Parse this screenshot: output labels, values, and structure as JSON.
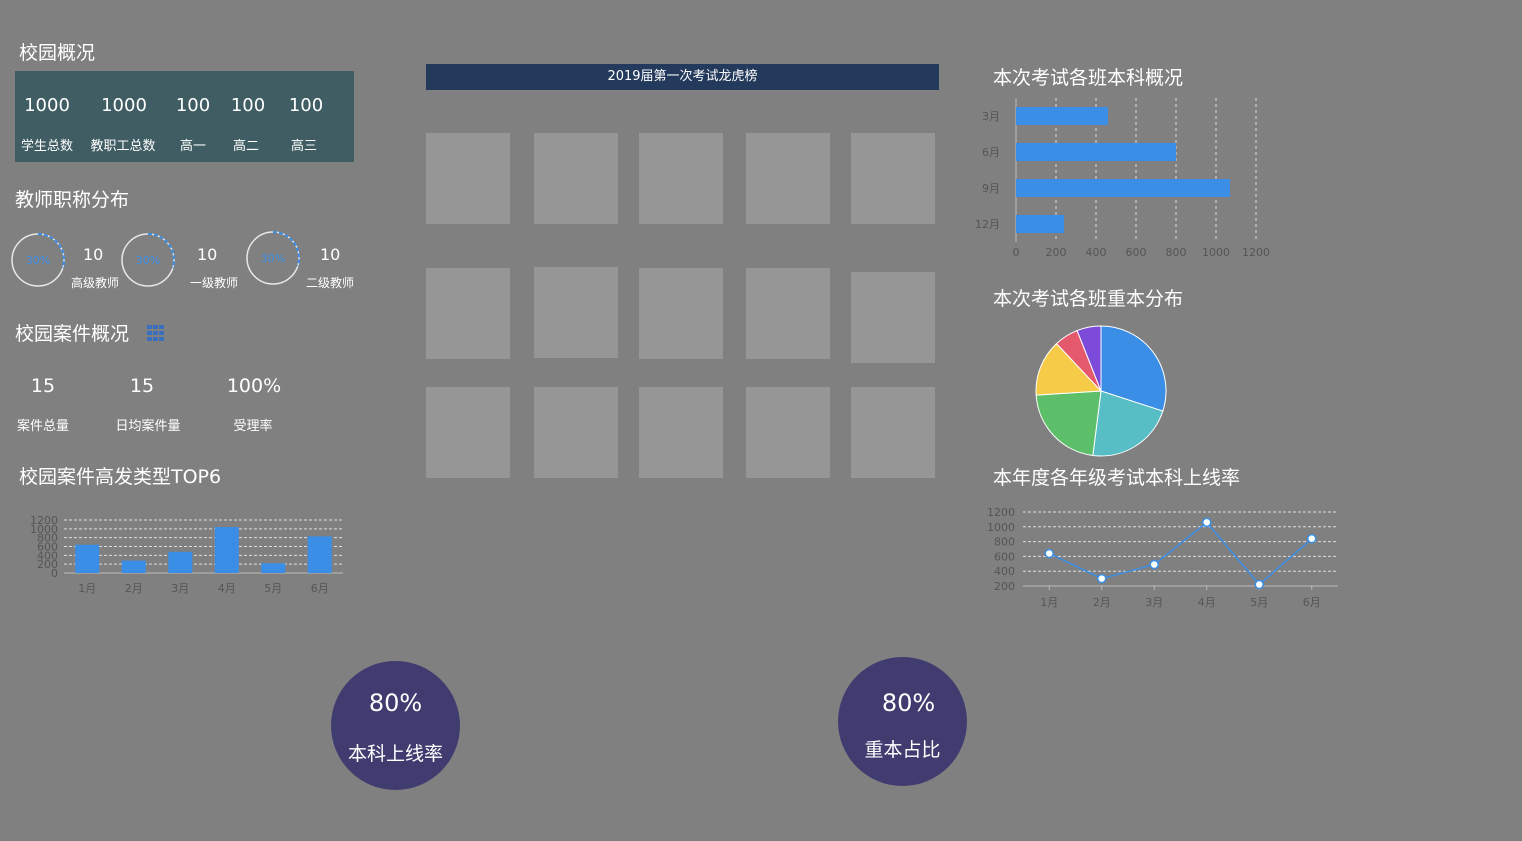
{
  "campus": {
    "title": "校园概况",
    "stats": [
      {
        "value": "1000",
        "label": "学生总数"
      },
      {
        "value": "1000",
        "label": "教职工总数"
      },
      {
        "value": "100",
        "label": "高一"
      },
      {
        "value": "100",
        "label": "高二"
      },
      {
        "value": "100",
        "label": "高三"
      }
    ]
  },
  "teachers": {
    "title": "教师职称分布",
    "items": [
      {
        "ring_text": "30%",
        "percent": 30,
        "count": "10",
        "label": "高级教师"
      },
      {
        "ring_text": "30%",
        "percent": 30,
        "count": "10",
        "label": "一级教师"
      },
      {
        "ring_text": "30%",
        "percent": 30,
        "count": "10",
        "label": "二级教师"
      }
    ]
  },
  "cases": {
    "title": "校园案件概况",
    "icon": "grid-icon",
    "stats": [
      {
        "value": "15",
        "label": "案件总量"
      },
      {
        "value": "15",
        "label": "日均案件量"
      },
      {
        "value": "100%",
        "label": "受理率"
      }
    ]
  },
  "case_top6": {
    "title": "校园案件高发类型TOP6"
  },
  "leaderboard": {
    "title": "2019届第一次考试龙虎榜"
  },
  "class_bachelor": {
    "title": "本次考试各班本科概况"
  },
  "class_key": {
    "title": "本次考试各班重本分布"
  },
  "grade_rate": {
    "title": "本年度各年级考试本科上线率"
  },
  "bubbles": [
    {
      "value": "80%",
      "label": "本科上线率"
    },
    {
      "value": "80%",
      "label": "重本占比"
    }
  ],
  "colors": {
    "background": "#808080",
    "accent": "#3a8ee6",
    "panel": "#3f5d63",
    "header": "#243a5c",
    "bubble": "#413c70"
  },
  "chart_data": [
    {
      "id": "case_top6",
      "type": "bar",
      "categories": [
        "1月",
        "2月",
        "3月",
        "4月",
        "5月",
        "6月"
      ],
      "values": [
        640,
        280,
        480,
        1040,
        220,
        830
      ],
      "yticks": [
        0,
        200,
        400,
        600,
        800,
        1000,
        1200
      ],
      "ylim": [
        0,
        1200
      ],
      "grid": true
    },
    {
      "id": "class_bachelor",
      "type": "bar",
      "orientation": "horizontal",
      "categories": [
        "3月",
        "6月",
        "9月",
        "12月"
      ],
      "values": [
        460,
        800,
        1070,
        240
      ],
      "xticks": [
        0,
        200,
        400,
        600,
        800,
        1000,
        1200
      ],
      "xlim": [
        0,
        1200
      ],
      "grid": true
    },
    {
      "id": "class_key",
      "type": "pie",
      "values": [
        30,
        22,
        22,
        14,
        6,
        6
      ],
      "colors": [
        "#3a8ee6",
        "#56bec4",
        "#5dbf6a",
        "#f5cb47",
        "#e45a6c",
        "#7d4bd9"
      ]
    },
    {
      "id": "grade_rate",
      "type": "line",
      "categories": [
        "1月",
        "2月",
        "3月",
        "4月",
        "5月",
        "6月"
      ],
      "values": [
        640,
        300,
        490,
        1060,
        220,
        840
      ],
      "yticks": [
        200,
        400,
        600,
        800,
        1000,
        1200
      ],
      "ylim": [
        200,
        1200
      ],
      "grid": true
    }
  ]
}
